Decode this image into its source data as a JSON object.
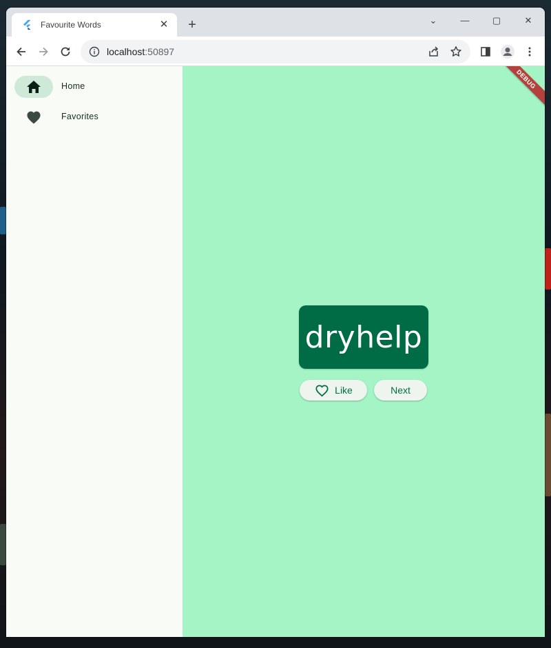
{
  "browser": {
    "tab_title": "Favourite Words",
    "tab_close": "✕",
    "new_tab": "+",
    "url_host": "localhost",
    "url_port": ":50897",
    "window_controls": [
      "⌄",
      "—",
      "▢",
      "✕"
    ]
  },
  "rail": {
    "items": [
      {
        "label": "Home",
        "icon": "home-icon",
        "selected": true
      },
      {
        "label": "Favorites",
        "icon": "favorite-icon",
        "selected": false
      }
    ]
  },
  "main": {
    "word": "dryhelp",
    "like_label": "Like",
    "next_label": "Next",
    "debug_banner": "DEBUG"
  },
  "colors": {
    "rail_bg": "#f8fbf6",
    "rail_indicator": "#cfe9d9",
    "main_bg": "#a4f4c6",
    "card_bg": "#006c45",
    "accent": "#006c45",
    "debug": "#b5413c"
  }
}
